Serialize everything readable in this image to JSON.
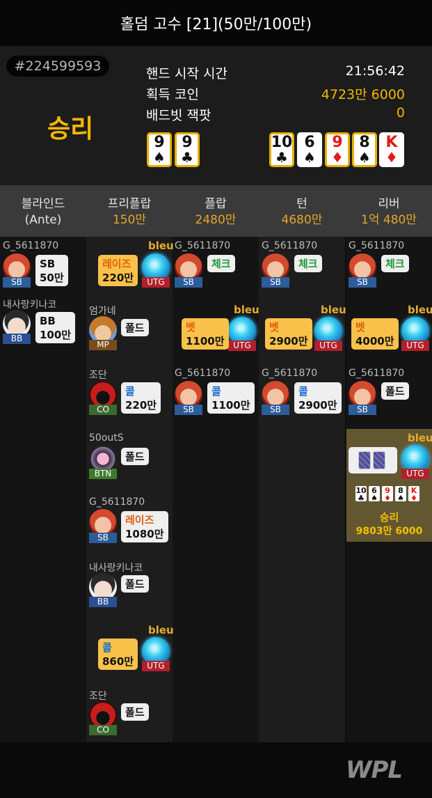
{
  "header": {
    "title": "홀덤 고수 [21](50만/100만)"
  },
  "summary": {
    "hand_id": "#224599593",
    "result": "승리",
    "rows": [
      {
        "label": "핸드 시작 시간",
        "value": "21:56:42"
      },
      {
        "label": "획득 코인",
        "value": "4723만 6000"
      },
      {
        "label": "배드빗 잭팟",
        "value": "0"
      }
    ],
    "hole_cards": [
      {
        "rank": "9",
        "suit": "♠"
      },
      {
        "rank": "9",
        "suit": "♣"
      }
    ],
    "board": [
      {
        "rank": "10",
        "suit": "♣"
      },
      {
        "rank": "6",
        "suit": "♠"
      },
      {
        "rank": "9",
        "suit": "♦"
      },
      {
        "rank": "8",
        "suit": "♠"
      },
      {
        "rank": "K",
        "suit": "♦"
      }
    ]
  },
  "phases": [
    {
      "name": "블라인드",
      "amount": "(Ante)"
    },
    {
      "name": "프리플랍",
      "amount": "150만"
    },
    {
      "name": "플랍",
      "amount": "2480만"
    },
    {
      "name": "턴",
      "amount": "4680만"
    },
    {
      "name": "리버",
      "amount": "1억 480만"
    }
  ],
  "blinds": [
    {
      "player": "G_5611870",
      "pos": "SB",
      "action": "SB",
      "amount": "50만"
    },
    {
      "player": "내사랑키나코",
      "pos": "BB",
      "action": "BB",
      "amount": "100만"
    }
  ],
  "preflop": [
    {
      "player": "bleu",
      "pos": "UTG",
      "action": "레이즈",
      "amount": "220만"
    },
    {
      "player": "엄가네",
      "pos": "MP",
      "action": "폴드"
    },
    {
      "player": "조단",
      "pos": "CO",
      "action": "콜",
      "amount": "220만"
    },
    {
      "player": "50outS",
      "pos": "BTN",
      "action": "폴드"
    },
    {
      "player": "G_5611870",
      "pos": "SB",
      "action": "레이즈",
      "amount": "1080만"
    },
    {
      "player": "내사랑키나코",
      "pos": "BB",
      "action": "폴드"
    },
    {
      "player": "bleu",
      "pos": "UTG",
      "action": "콜",
      "amount": "860만"
    },
    {
      "player": "조단",
      "pos": "CO",
      "action": "폴드"
    }
  ],
  "flop": [
    {
      "player": "G_5611870",
      "pos": "SB",
      "action": "체크"
    },
    {
      "player": "bleu",
      "pos": "UTG",
      "action": "벳",
      "amount": "1100만"
    },
    {
      "player": "G_5611870",
      "pos": "SB",
      "action": "콜",
      "amount": "1100만"
    }
  ],
  "turn": [
    {
      "player": "G_5611870",
      "pos": "SB",
      "action": "체크"
    },
    {
      "player": "bleu",
      "pos": "UTG",
      "action": "벳",
      "amount": "2900만"
    },
    {
      "player": "G_5611870",
      "pos": "SB",
      "action": "콜",
      "amount": "2900만"
    }
  ],
  "river": [
    {
      "player": "G_5611870",
      "pos": "SB",
      "action": "체크"
    },
    {
      "player": "bleu",
      "pos": "UTG",
      "action": "벳",
      "amount": "4000만"
    },
    {
      "player": "G_5611870",
      "pos": "SB",
      "action": "폴드"
    }
  ],
  "winner": {
    "player": "bleu",
    "pos": "UTG",
    "result": "승리",
    "amount": "9803만 6000"
  },
  "footer": {
    "logo": "WPL"
  },
  "colors": {
    "accent": "#f5b800",
    "check": "#1e9a3a",
    "call": "#1b68d2",
    "raise": "#e06010"
  }
}
